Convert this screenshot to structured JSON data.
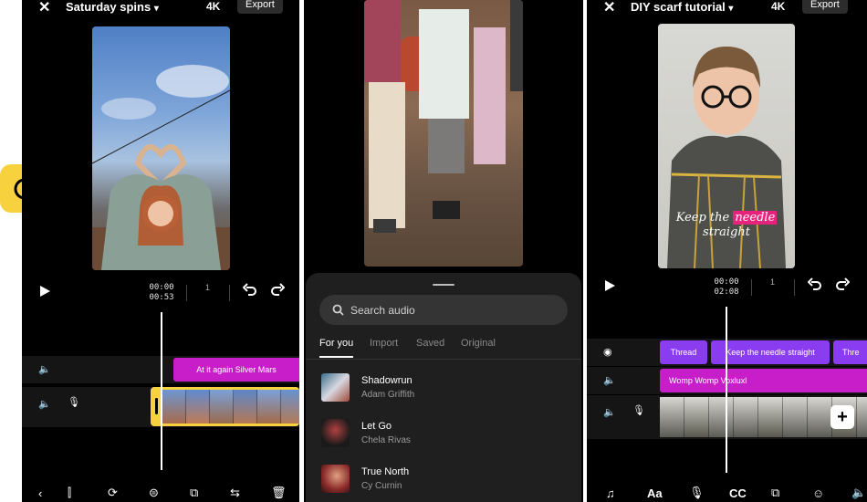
{
  "left": {
    "title": "Saturday spins",
    "resolution": "4K",
    "export_label": "Export",
    "time_current": "00:00",
    "time_total": "00:53",
    "frame_num": "1",
    "audio_chip": "At it again  Silver Mars"
  },
  "middle": {
    "search_placeholder": "Search audio",
    "tabs": [
      "For you",
      "Import",
      "Saved",
      "Original"
    ],
    "songs": [
      {
        "title": "Shadowrun",
        "artist": "Adam Griffith"
      },
      {
        "title": "Let Go",
        "artist": "Chela Rivas"
      },
      {
        "title": "True North",
        "artist": "Cy Curnin"
      }
    ]
  },
  "right": {
    "title": "DIY scarf tutorial",
    "resolution": "4K",
    "export_label": "Export",
    "caption_pre": "Keep the ",
    "caption_highlight": "needle",
    "caption_post": "straight",
    "time_current": "00:00",
    "time_total": "02:08",
    "frame_num": "1",
    "text_chips": [
      "Thread",
      "Keep the needle straight",
      "Thre"
    ],
    "audio_chip": "Womp Womp  Voxluxl",
    "bottom_icons": [
      "music-icon",
      "text-icon",
      "mic-icon",
      "captions-icon",
      "overlay-icon",
      "sticker-icon",
      "volume-icon"
    ],
    "cc_label": "CC",
    "aa_label": "Aa"
  },
  "colors": {
    "accent_yellow": "#f7d23e",
    "chip_magenta": "#c81ec9",
    "chip_purple": "#8a3cf0",
    "caption_pink": "#e8237b"
  }
}
